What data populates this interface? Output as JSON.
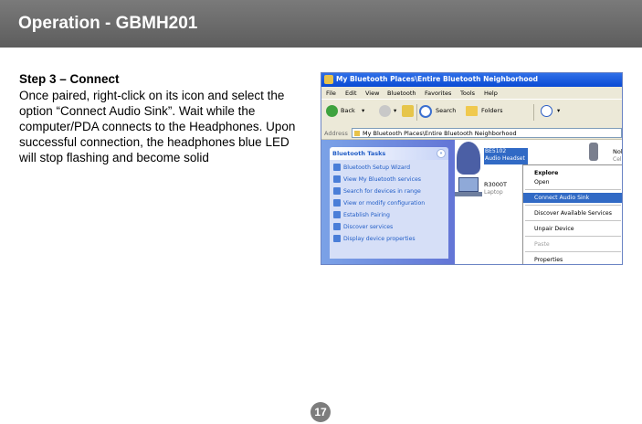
{
  "header": {
    "title": "Operation - GBMH201"
  },
  "step": {
    "title": "Step 3 – Connect",
    "body": "Once paired, right-click on its icon and select the option “Connect Audio Sink”.  Wait while the computer/PDA connects to the Headphones. Upon successful connection, the headphones blue LED will stop flashing and become solid"
  },
  "page_number": "17",
  "screenshot": {
    "window_title": "My Bluetooth Places\\Entire Bluetooth Neighborhood",
    "menu": [
      "File",
      "Edit",
      "View",
      "Bluetooth",
      "Favorites",
      "Tools",
      "Help"
    ],
    "toolbar": {
      "back": "Back",
      "search": "Search",
      "folders": "Folders"
    },
    "address": {
      "label": "Address",
      "value": "My Bluetooth Places\\Entire Bluetooth Neighborhood"
    },
    "tasks": {
      "header": "Bluetooth Tasks",
      "items": [
        "Bluetooth Setup Wizard",
        "View My Bluetooth services",
        "Search for devices in range",
        "View or modify configuration",
        "Establish Pairing",
        "Discover services",
        "Display device properties"
      ]
    },
    "devices": {
      "headset_name": "BE5102",
      "headset_type": "Audio Headset",
      "laptop_name": "R3000T",
      "laptop_type": "Laptop",
      "phone_name": "Nok",
      "phone_type": "Cell"
    },
    "context_menu": {
      "items": [
        "Explore",
        "Open",
        "Connect Audio Sink",
        "Discover Available Services",
        "Unpair Device",
        "Paste",
        "Properties"
      ]
    }
  }
}
